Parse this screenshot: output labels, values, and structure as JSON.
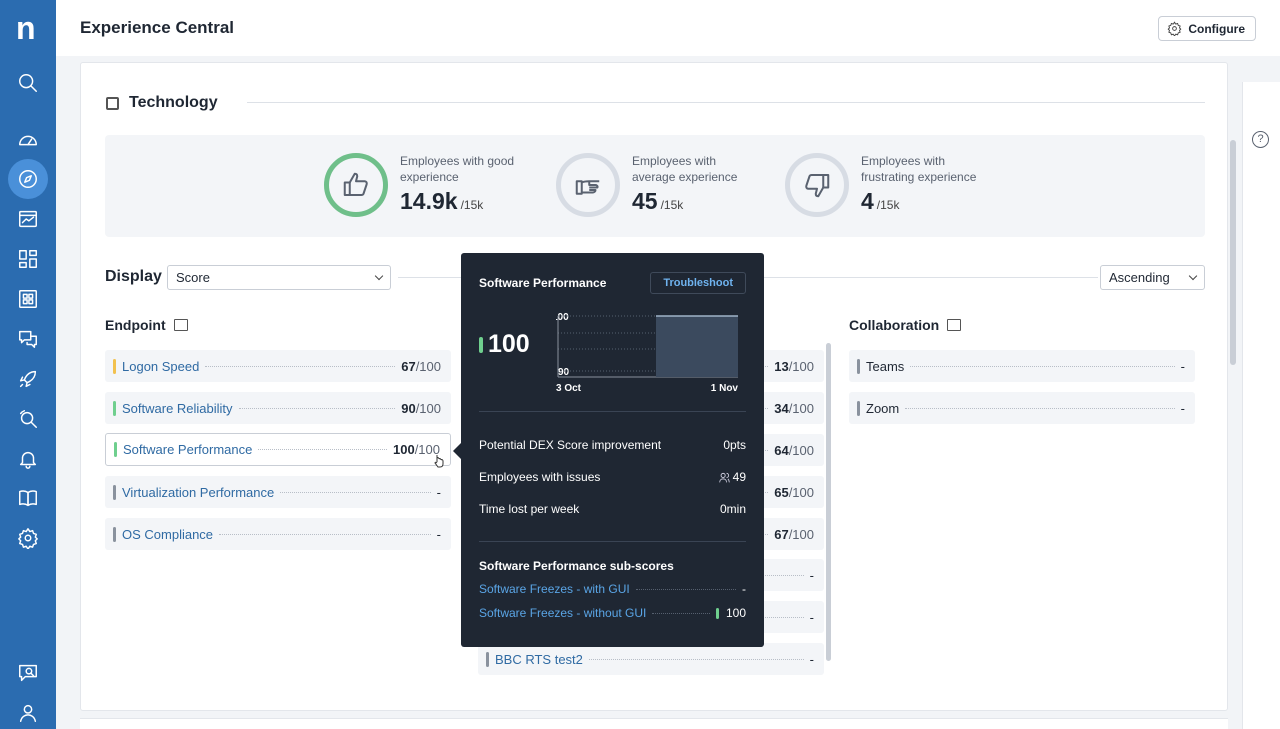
{
  "app": {
    "logo": "n",
    "page_title": "Experience Central"
  },
  "header": {
    "configure_label": "Configure"
  },
  "sidebar": {
    "items": [
      {
        "icon": "search-icon",
        "active": false
      },
      {
        "icon": "speedometer-icon",
        "active": false
      },
      {
        "icon": "compass-icon",
        "active": true
      },
      {
        "icon": "chart-window-icon",
        "active": false
      },
      {
        "icon": "dashboard-icon",
        "active": false
      },
      {
        "icon": "apps-grid-icon",
        "active": false
      },
      {
        "icon": "chat-icon",
        "active": false
      },
      {
        "icon": "rocket-icon",
        "active": false
      },
      {
        "icon": "investigate-icon",
        "active": false
      },
      {
        "icon": "bell-icon",
        "active": false
      },
      {
        "icon": "book-icon",
        "active": false
      },
      {
        "icon": "gear-icon",
        "active": false
      }
    ],
    "bottom": [
      {
        "icon": "feedback-icon"
      },
      {
        "icon": "user-icon"
      }
    ]
  },
  "section": {
    "title": "Technology"
  },
  "stats": [
    {
      "label": "Employees with good experience",
      "value": "14.9k",
      "denominator": "/15k",
      "icon": "thumbs-up-icon",
      "color": "#6fbf8a"
    },
    {
      "label": "Employees with average experience",
      "value": "45",
      "denominator": "/15k",
      "icon": "hand-pointing-icon",
      "color": "#d7dce4"
    },
    {
      "label": "Employees with frustrating experience",
      "value": "4",
      "denominator": "/15k",
      "icon": "thumbs-down-icon",
      "color": "#d7dce4"
    }
  ],
  "display": {
    "label": "Display",
    "selected": "Score",
    "sort_selected": "Ascending"
  },
  "columns": {
    "endpoint": {
      "title": "Endpoint",
      "rows": [
        {
          "name": "Logon Speed",
          "value": "67",
          "den": "/100",
          "color": "#f2c14e"
        },
        {
          "name": "Software Reliability",
          "value": "90",
          "den": "/100",
          "color": "#6fcf8e"
        },
        {
          "name": "Software Performance",
          "value": "100",
          "den": "/100",
          "color": "#6fcf8e"
        },
        {
          "name": "Virtualization Performance",
          "value": "-",
          "den": "",
          "color": "#8a929e"
        },
        {
          "name": "OS Compliance",
          "value": "-",
          "den": "",
          "color": "#8a929e"
        }
      ]
    },
    "middle": {
      "rows": [
        {
          "value": "13",
          "den": "/100"
        },
        {
          "value": "34",
          "den": "/100"
        },
        {
          "value": "64",
          "den": "/100"
        },
        {
          "value": "65",
          "den": "/100"
        },
        {
          "value": "67",
          "den": "/100"
        },
        {
          "value": "-",
          "den": ""
        },
        {
          "value": "-",
          "den": ""
        },
        {
          "name": "BBC RTS test2",
          "value": "-",
          "den": ""
        }
      ]
    },
    "collaboration": {
      "title": "Collaboration",
      "rows": [
        {
          "name": "Teams",
          "value": "-"
        },
        {
          "name": "Zoom",
          "value": "-"
        }
      ]
    }
  },
  "tooltip": {
    "title": "Software Performance",
    "troubleshoot_label": "Troubleshoot",
    "score": "100",
    "chart": {
      "y_top_label": "100",
      "y_bottom_label": "90",
      "x_start_label": "3 Oct",
      "x_end_label": "1 Nov"
    },
    "rows": [
      {
        "label": "Potential DEX Score improvement",
        "value": "0pts"
      },
      {
        "label": "Employees with issues",
        "value": "49"
      },
      {
        "label": "Time lost per week",
        "value": "0min"
      }
    ],
    "subscores_title": "Software Performance sub-scores",
    "subscores": [
      {
        "name": "Software Freezes - with GUI",
        "value": "-"
      },
      {
        "name": "Software Freezes - without GUI",
        "value": "100"
      }
    ]
  },
  "help": {
    "glyph": "?"
  }
}
